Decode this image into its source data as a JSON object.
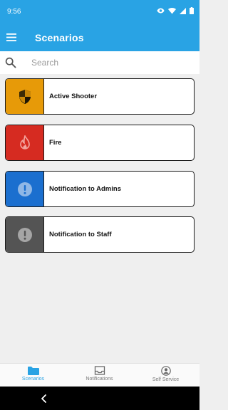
{
  "status_bar": {
    "time": "9:56"
  },
  "app_bar": {
    "title": "Scenarios"
  },
  "search": {
    "placeholder": "Search",
    "value": ""
  },
  "scenarios": [
    {
      "label": "Active Shooter",
      "icon": "shield-icon",
      "color": "#e79a08"
    },
    {
      "label": "Fire",
      "icon": "fire-icon",
      "color": "#d62b21"
    },
    {
      "label": "Notification to Admins",
      "icon": "alert-circle-icon",
      "color": "#1b6fcf"
    },
    {
      "label": "Notification to Staff",
      "icon": "alert-circle-icon",
      "color": "#545454"
    }
  ],
  "bottom_nav": {
    "tabs": [
      {
        "label": "Scenarios",
        "icon": "folder-icon",
        "active": true
      },
      {
        "label": "Notifications",
        "icon": "inbox-icon",
        "active": false
      },
      {
        "label": "Self Service",
        "icon": "account-icon",
        "active": false
      }
    ]
  },
  "colors": {
    "accent": "#29a3e4"
  }
}
